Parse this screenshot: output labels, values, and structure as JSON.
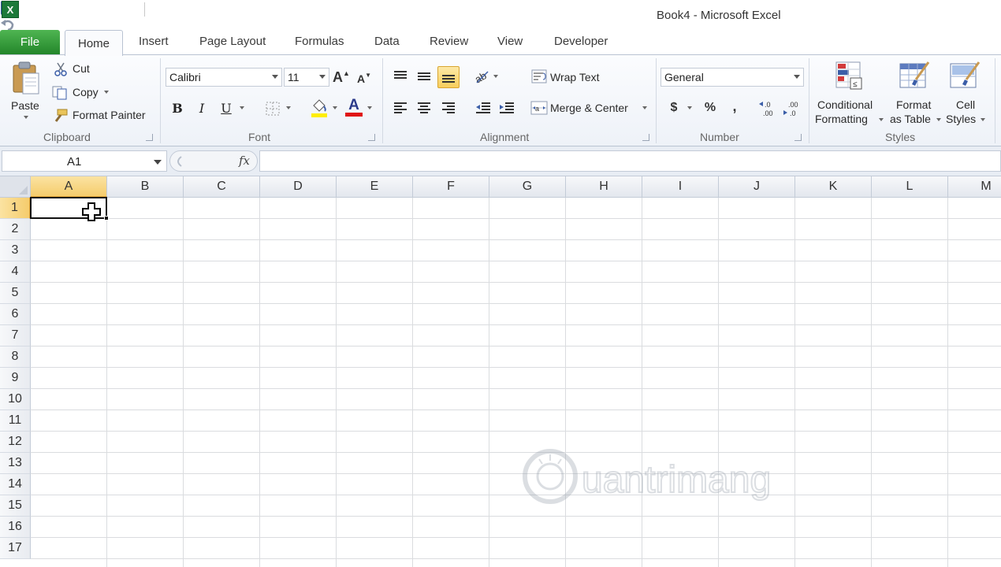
{
  "window": {
    "title": "Book4  -  Microsoft Excel"
  },
  "quick_access": [
    {
      "name": "save-icon"
    },
    {
      "name": "undo-icon"
    },
    {
      "name": "redo-icon"
    },
    {
      "name": "calculator-icon"
    },
    {
      "name": "customize-qat-icon"
    }
  ],
  "tabs": {
    "file": "File",
    "home": "Home",
    "items": [
      "Insert",
      "Page Layout",
      "Formulas",
      "Data",
      "Review",
      "View",
      "Developer"
    ]
  },
  "ribbon": {
    "clipboard": {
      "label": "Clipboard",
      "paste": "Paste",
      "cut": "Cut",
      "copy": "Copy",
      "format_painter": "Format Painter"
    },
    "font": {
      "label": "Font",
      "font_name": "Calibri",
      "font_size": "11",
      "bold": "B",
      "italic": "I",
      "underline": "U",
      "font_color_letter": "A",
      "grow_letter": "A",
      "shrink_letter": "A"
    },
    "alignment": {
      "label": "Alignment",
      "wrap_text": "Wrap Text",
      "merge_center": "Merge & Center"
    },
    "number": {
      "label": "Number",
      "format": "General",
      "currency": "$",
      "percent": "%",
      "comma": ",",
      "inc_decimal": "←.0\n.00",
      "dec_decimal": ".00\n→.0"
    },
    "styles": {
      "label": "Styles",
      "conditional_1": "Conditional",
      "conditional_2": "Formatting",
      "format_table_1": "Format",
      "format_table_2": "as Table",
      "cell_styles_1": "Cell",
      "cell_styles_2": "Styles"
    }
  },
  "formula_bar": {
    "name_box": "A1",
    "fx": "fx",
    "value": ""
  },
  "sheet": {
    "columns": [
      "A",
      "B",
      "C",
      "D",
      "E",
      "F",
      "G",
      "H",
      "I",
      "J",
      "K",
      "L",
      "M"
    ],
    "rows": [
      "1",
      "2",
      "3",
      "4",
      "5",
      "6",
      "7",
      "8",
      "9",
      "10",
      "11",
      "12",
      "13",
      "14",
      "15",
      "16",
      "17"
    ],
    "active_cell": "A1"
  },
  "watermark": "Quantrimang",
  "colors": {
    "file_tab": "#2d8f33",
    "selection_header": "#f5cc6c",
    "gridline": "#dadcdf"
  }
}
